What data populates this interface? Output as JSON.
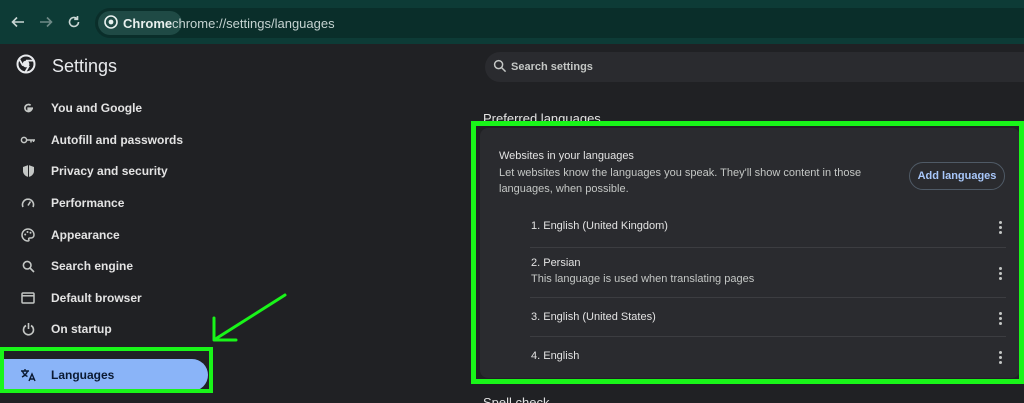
{
  "browser": {
    "chip_label": "Chrome",
    "url": "chrome://settings/languages",
    "icons": [
      "back-icon",
      "forward-icon",
      "reload-icon"
    ]
  },
  "sidebar": {
    "title": "Settings",
    "items": [
      {
        "label": "You and Google",
        "icon": "google-icon"
      },
      {
        "label": "Autofill and passwords",
        "icon": "key-icon"
      },
      {
        "label": "Privacy and security",
        "icon": "shield-icon"
      },
      {
        "label": "Performance",
        "icon": "speedometer-icon"
      },
      {
        "label": "Appearance",
        "icon": "palette-icon"
      },
      {
        "label": "Search engine",
        "icon": "search-icon"
      },
      {
        "label": "Default browser",
        "icon": "browser-window-icon"
      },
      {
        "label": "On startup",
        "icon": "power-icon"
      },
      {
        "label": "Languages",
        "icon": "translate-icon",
        "active": true
      }
    ]
  },
  "search": {
    "placeholder": "Search settings"
  },
  "main": {
    "section_title": "Preferred languages",
    "card": {
      "title": "Websites in your languages",
      "description": "Let websites know the languages you speak. They'll show content in those languages, when possible.",
      "add_button": "Add languages",
      "languages": [
        {
          "name": "1. English (United Kingdom)",
          "sub": ""
        },
        {
          "name": "2. Persian",
          "sub": "This language is used when translating pages"
        },
        {
          "name": "3. English (United States)",
          "sub": ""
        },
        {
          "name": "4. English",
          "sub": ""
        }
      ]
    },
    "next_section_title": "Spell check"
  },
  "colors": {
    "accent": "#8ab4f8",
    "highlight": "#19f519",
    "topbar": "#0d3b36"
  }
}
